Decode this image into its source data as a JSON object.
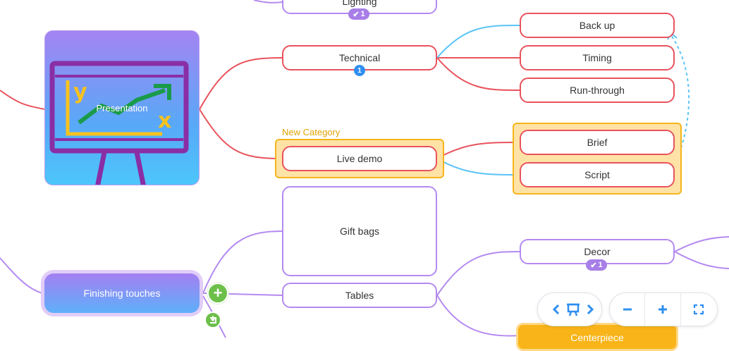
{
  "nodes": {
    "presentation": "Presentation",
    "lighting": "Lighting",
    "technical": "Technical",
    "back_up": "Back up",
    "timing": "Timing",
    "run_through": "Run-through",
    "live_demo": "Live demo",
    "brief": "Brief",
    "script": "Script",
    "finishing_touches": "Finishing touches",
    "gift_bags": "Gift bags",
    "tables": "Tables",
    "decor": "Decor",
    "partial_orange_node": "Centerpiece"
  },
  "badges": {
    "lighting_tasks": "1",
    "technical_comments": "1",
    "decor_tasks": "1"
  },
  "group": {
    "label": "New Category"
  },
  "icons": {
    "task": "checkmark-icon",
    "comment": "comment-icon",
    "add": "plus-icon",
    "float": "reattach-icon",
    "presentation": "presentation-board-icon",
    "prev": "chevron-left-icon",
    "next": "chevron-right-icon",
    "present": "presentation-mode-icon",
    "zoom_out": "minus-icon",
    "zoom_in": "plus-icon",
    "fit": "fit-screen-icon"
  },
  "colors": {
    "red_branch": "#e8535d",
    "purple_branch": "#b48af0",
    "blue_link": "#5bc4f5",
    "group_fill": "#ffe2a6",
    "group_border": "#f5b51c",
    "accent_blue": "#2f8ff0",
    "add_green": "#6cc04a"
  }
}
